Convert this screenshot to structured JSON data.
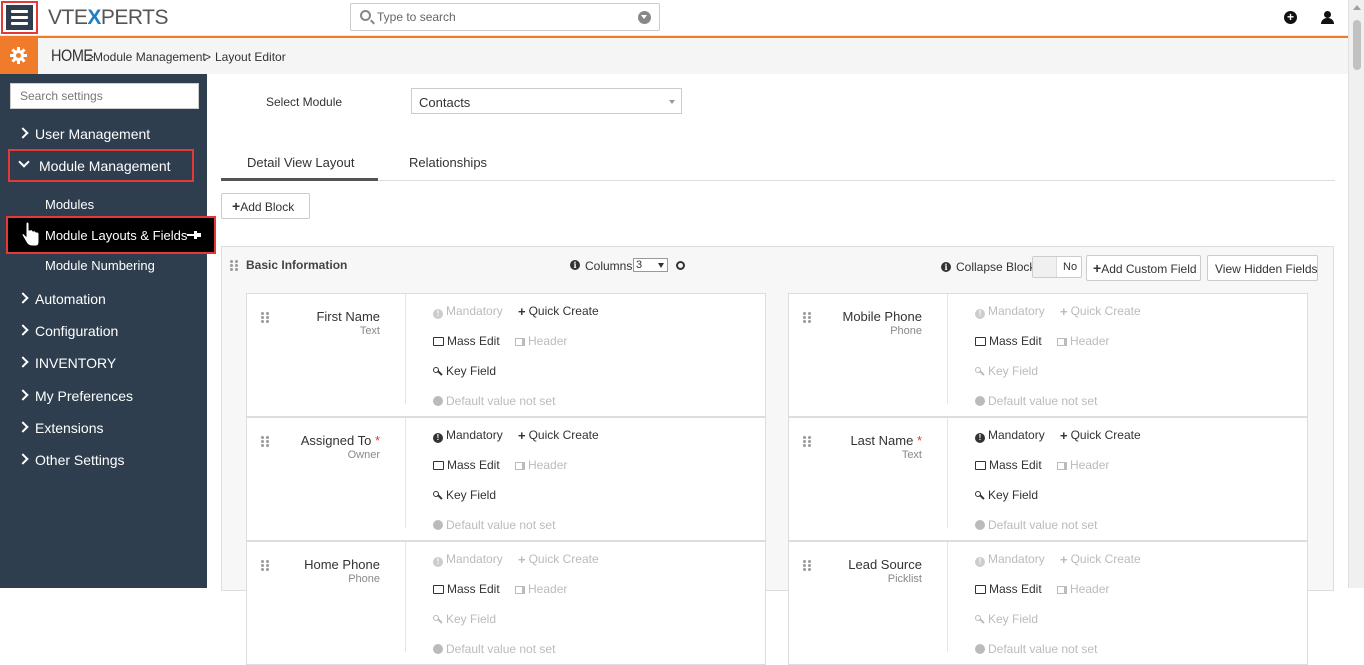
{
  "header": {
    "logo_part1": "VTE",
    "logo_x": "X",
    "logo_part2": "PERTS",
    "search_placeholder": "Type to search"
  },
  "breadcrumb": {
    "home": "HOME",
    "sep1": ">",
    "module_management": "Module Management",
    "sep2": ">",
    "layout_editor": "Layout Editor"
  },
  "sidebar": {
    "search_placeholder": "Search settings",
    "items": [
      {
        "label": "User Management"
      },
      {
        "label": "Module Management"
      },
      {
        "label": "Automation"
      },
      {
        "label": "Configuration"
      },
      {
        "label": "INVENTORY"
      },
      {
        "label": "My Preferences"
      },
      {
        "label": "Extensions"
      },
      {
        "label": "Other Settings"
      }
    ],
    "subitems": [
      {
        "label": "Modules"
      },
      {
        "label": "Module Layouts & Fields"
      },
      {
        "label": "Module Numbering"
      }
    ]
  },
  "main": {
    "select_module_label": "Select Module",
    "select_module_value": "Contacts",
    "tabs": [
      {
        "label": "Detail View Layout"
      },
      {
        "label": "Relationships"
      }
    ],
    "add_block_label": "Add Block",
    "block": {
      "title": "Basic Information",
      "columns_label": "Columns",
      "columns_value": "3",
      "collapse_label": "Collapse Block",
      "collapse_value": "No",
      "add_custom_field_label": "Add Custom Field",
      "view_hidden_fields_label": "View Hidden Fields"
    },
    "options": {
      "mandatory": "Mandatory",
      "quick_create": "Quick Create",
      "mass_edit": "Mass Edit",
      "header": "Header",
      "key_field": "Key Field",
      "default_value": "Default value not set"
    },
    "fields": [
      {
        "name": "First Name",
        "type": "Text",
        "required": "",
        "mandatory_on": false,
        "quick_on": true,
        "key_on": true
      },
      {
        "name": "Mobile Phone",
        "type": "Phone",
        "required": "",
        "mandatory_on": false,
        "quick_on": false,
        "key_on": false
      },
      {
        "name": "Assigned To",
        "type": "Owner",
        "required": "*",
        "mandatory_on": true,
        "quick_on": true,
        "key_on": true
      },
      {
        "name": "Last Name",
        "type": "Text",
        "required": "*",
        "mandatory_on": true,
        "quick_on": true,
        "key_on": true
      },
      {
        "name": "Home Phone",
        "type": "Phone",
        "required": "",
        "mandatory_on": false,
        "quick_on": false,
        "key_on": false
      },
      {
        "name": "Lead Source",
        "type": "Picklist",
        "required": "",
        "mandatory_on": false,
        "quick_on": false,
        "key_on": false
      }
    ]
  },
  "colors": {
    "sidebar_bg": "#2e3e4e",
    "accent_orange": "#f07b2b",
    "highlight_red": "#e53935",
    "logo_blue": "#1f7fc4"
  }
}
